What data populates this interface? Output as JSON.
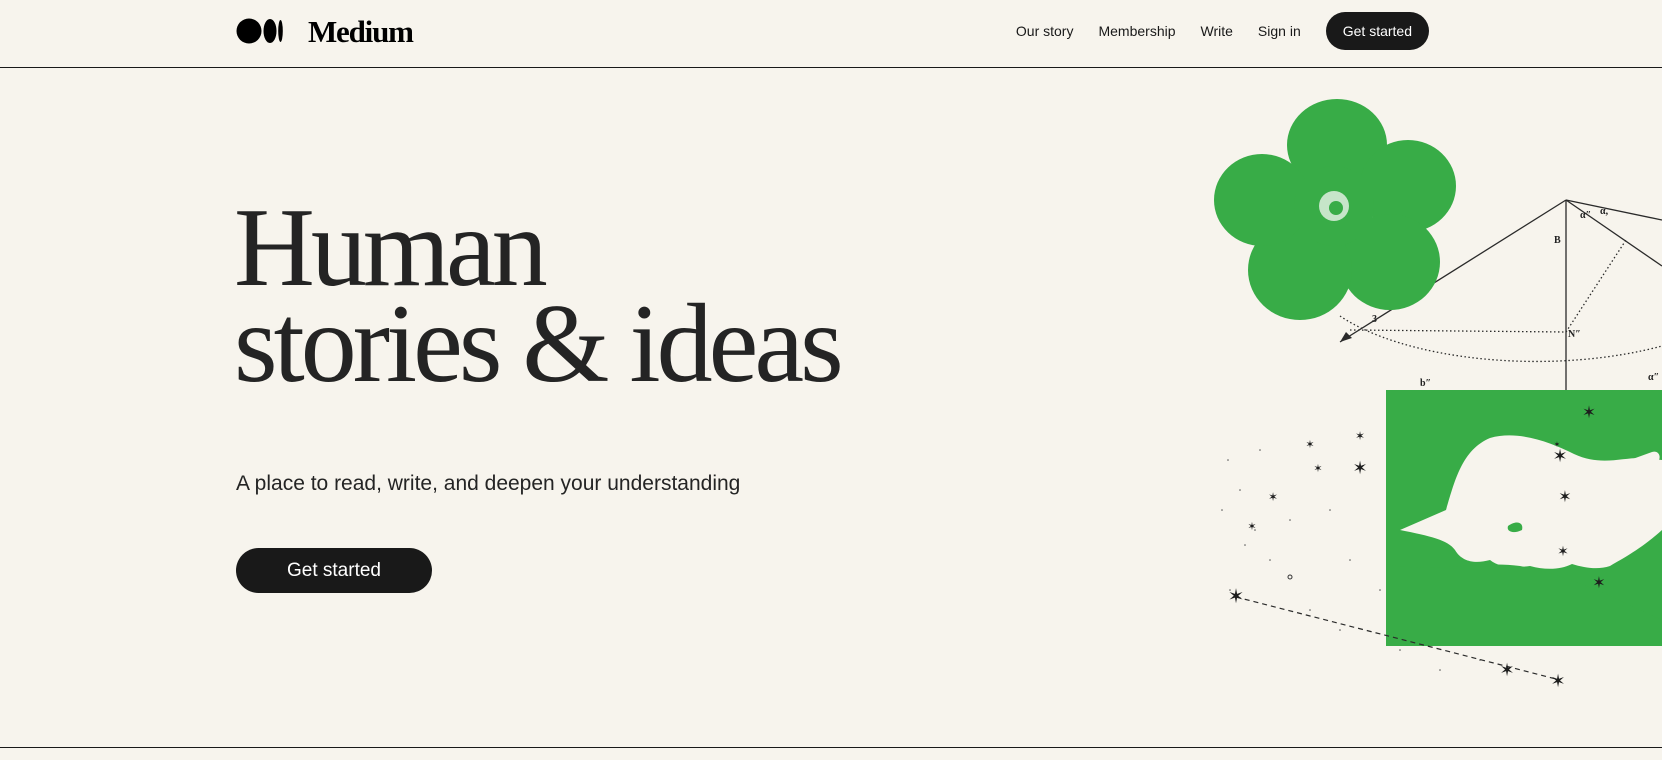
{
  "brand": {
    "name": "Medium",
    "logo_icon": "medium-dots-logo"
  },
  "nav": {
    "links": [
      "Our story",
      "Membership",
      "Write",
      "Sign in"
    ],
    "cta_label": "Get started"
  },
  "hero": {
    "title_line1": "Human",
    "title_line2": "stories & ideas",
    "subtitle": "A place to read, write, and deepen your understanding",
    "cta_label": "Get started",
    "illustration": "flower-geometry-hand-writing-illustration"
  },
  "colors": {
    "background": "#f7f4ed",
    "ink": "#191919",
    "accent_green": "#38ac47"
  }
}
